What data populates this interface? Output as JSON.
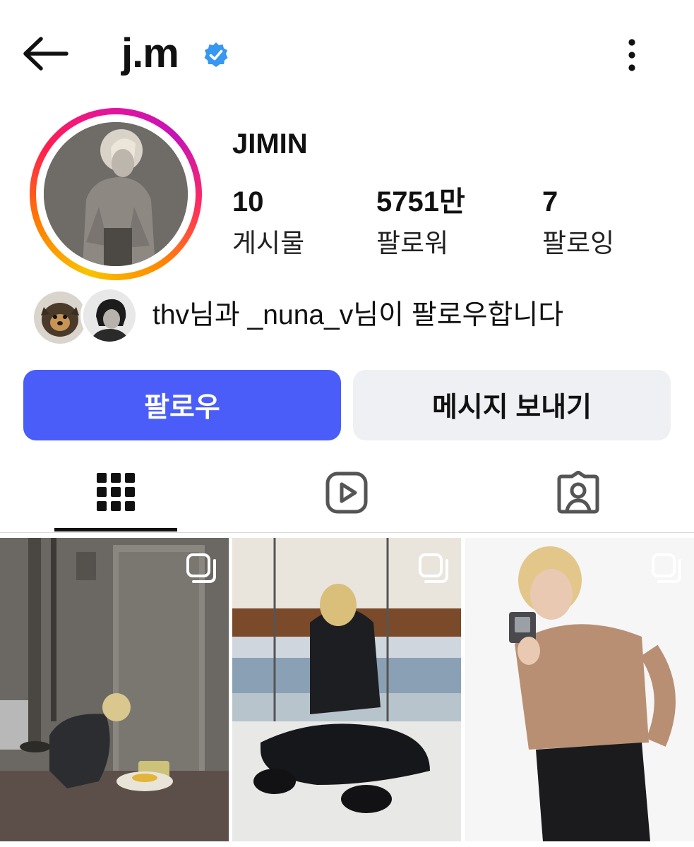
{
  "header": {
    "username": "j.m",
    "back_icon": "arrow-left-icon",
    "verified_icon": "verified-badge-icon",
    "more_icon": "more-vertical-icon"
  },
  "profile": {
    "display_name": "JIMIN",
    "stats": [
      {
        "value": "10",
        "label": "게시물"
      },
      {
        "value": "5751만",
        "label": "팔로워"
      },
      {
        "value": "7",
        "label": "팔로잉"
      }
    ],
    "followed_by_text": "thv님과 _nuna_v님이 팔로우합니다"
  },
  "actions": {
    "follow_label": "팔로우",
    "message_label": "메시지 보내기"
  },
  "tabs": [
    {
      "icon": "grid-icon",
      "selected": true
    },
    {
      "icon": "reels-icon",
      "selected": false
    },
    {
      "icon": "tagged-icon",
      "selected": false
    }
  ],
  "colors": {
    "follow_button": "#4a5df9",
    "message_button": "#eff0f4",
    "verified": "#3897f0"
  }
}
